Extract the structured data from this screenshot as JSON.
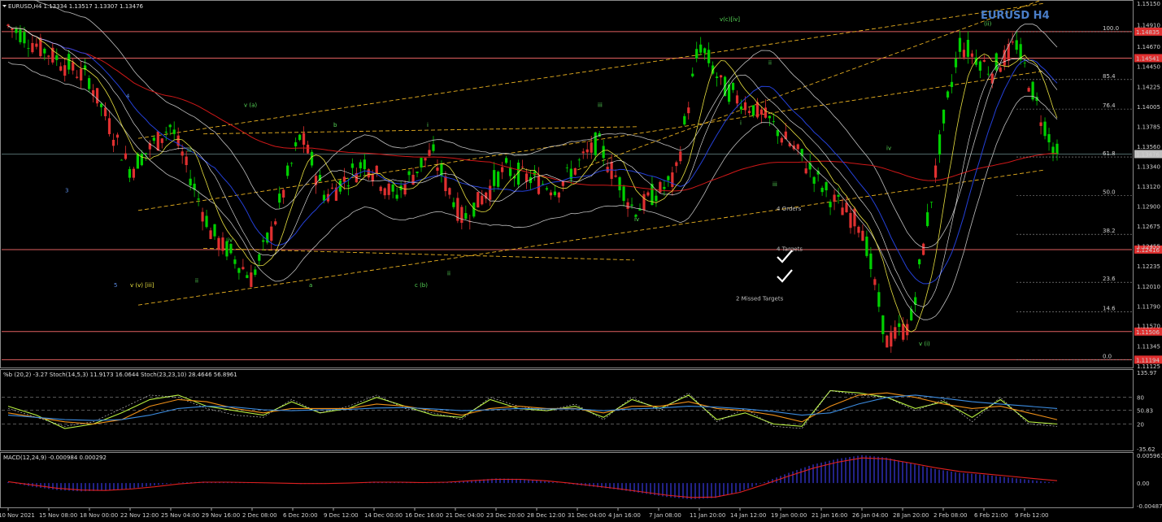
{
  "header": {
    "main": "EURUSD,H4  1.13334 1.13517 1.13307 1.13476",
    "osc": "%b (20,2) -3.27  Stoch(14,5,3) 11.9173 16.0644  Stoch(23,23,10) 28.4646 56.8961",
    "macd": "MACD(12,24,9) -0.000984 0.000292"
  },
  "title": "EURUSD H4",
  "colors": {
    "candle_up": "#00d000",
    "candle_down": "#e03030",
    "ma_red": "#d01818",
    "ma_blue": "#2440d8",
    "ma_yellow": "#e8e040",
    "bollinger": "#bfbfbf",
    "channel": "#e8b020",
    "level_line": "#e06060",
    "wave_green": "#58d858",
    "wave_yellow": "#e8e040",
    "wave_blue": "#5a8ae0",
    "pctb": "#b8f040",
    "stoch_orange": "#f09018",
    "stoch_blue": "#3c8ce0",
    "macd_hist": "#3838e0",
    "macd_signal": "#e02020"
  },
  "chart_data": [
    {
      "type": "candlestick",
      "symbol": "EURUSD",
      "timeframe": "H4",
      "ylim": [
        1.11125,
        1.1515
      ],
      "y_ticks": [
        1.1515,
        1.1491,
        1.1467,
        1.1445,
        1.14225,
        1.14005,
        1.13785,
        1.1356,
        1.1334,
        1.1312,
        1.129,
        1.12675,
        1.12455,
        1.12235,
        1.1201,
        1.1179,
        1.1157,
        1.11345,
        1.11125
      ],
      "current_price": 1.13476,
      "highlighted_levels": [
        1.14835,
        1.14541,
        1.12416,
        1.11506,
        1.11194
      ],
      "x_ticks": [
        "10 Nov 2021",
        "15 Nov 08:00",
        "18 Nov 00:00",
        "22 Nov 12:00",
        "25 Nov 04:00",
        "29 Nov 16:00",
        "2 Dec 08:00",
        "6 Dec 20:00",
        "9 Dec 12:00",
        "14 Dec 00:00",
        "16 Dec 16:00",
        "21 Dec 04:00",
        "23 Dec 20:00",
        "28 Dec 12:00",
        "31 Dec 04:00",
        "4 Jan 16:00",
        "7 Jan 08:00",
        "11 Jan 20:00",
        "14 Jan 12:00",
        "19 Jan 00:00",
        "21 Jan 16:00",
        "26 Jan 04:00",
        "28 Jan 20:00",
        "2 Feb 08:00",
        "6 Feb 21:00",
        "9 Feb 12:00"
      ],
      "fib_levels": [
        "100.0",
        "85.4",
        "76.4",
        "61.8",
        "50.0",
        "38.2",
        "23.6",
        "14.6",
        "0.0"
      ],
      "key_prices": [
        {
          "x": 0,
          "p": 1.149
        },
        {
          "x": 2,
          "p": 1.143
        },
        {
          "x": 3,
          "p": 1.133
        },
        {
          "x": 4,
          "p": 1.138
        },
        {
          "x": 5,
          "p": 1.126
        },
        {
          "x": 6,
          "p": 1.121
        },
        {
          "x": 6.5,
          "p": 1.1265
        },
        {
          "x": 7.2,
          "p": 1.137
        },
        {
          "x": 7.8,
          "p": 1.13
        },
        {
          "x": 8.8,
          "p": 1.134
        },
        {
          "x": 9.5,
          "p": 1.13
        },
        {
          "x": 10.4,
          "p": 1.135
        },
        {
          "x": 11.2,
          "p": 1.1275
        },
        {
          "x": 12.2,
          "p": 1.133
        },
        {
          "x": 13.5,
          "p": 1.131
        },
        {
          "x": 14.5,
          "p": 1.136
        },
        {
          "x": 15.4,
          "p": 1.1285
        },
        {
          "x": 16.4,
          "p": 1.132
        },
        {
          "x": 17.0,
          "p": 1.147
        },
        {
          "x": 17.6,
          "p": 1.142
        },
        {
          "x": 18.6,
          "p": 1.139
        },
        {
          "x": 19.5,
          "p": 1.1345
        },
        {
          "x": 20.2,
          "p": 1.13
        },
        {
          "x": 21.0,
          "p": 1.127
        },
        {
          "x": 21.6,
          "p": 1.114
        },
        {
          "x": 22.2,
          "p": 1.116
        },
        {
          "x": 23.0,
          "p": 1.138
        },
        {
          "x": 23.4,
          "p": 1.147
        },
        {
          "x": 24.2,
          "p": 1.144
        },
        {
          "x": 24.8,
          "p": 1.147
        },
        {
          "x": 25.4,
          "p": 1.139
        },
        {
          "x": 25.8,
          "p": 1.1345
        }
      ],
      "wave_labels": [
        {
          "text": "v (a)",
          "x": 5.8,
          "p": 1.14,
          "c": "green"
        },
        {
          "text": "iii",
          "x": 4.4,
          "p": 1.135,
          "c": "green"
        },
        {
          "text": "iv",
          "x": 5.4,
          "p": 1.125,
          "c": "green"
        },
        {
          "text": "ii",
          "x": 4.6,
          "p": 1.1205,
          "c": "green"
        },
        {
          "text": "b",
          "x": 8.0,
          "p": 1.1378,
          "c": "green"
        },
        {
          "text": "a",
          "x": 7.4,
          "p": 1.12,
          "c": "green"
        },
        {
          "text": "i",
          "x": 10.3,
          "p": 1.1378,
          "c": "green"
        },
        {
          "text": "c (b)",
          "x": 10.0,
          "p": 1.12,
          "c": "green"
        },
        {
          "text": "ii",
          "x": 10.8,
          "p": 1.1213,
          "c": "green"
        },
        {
          "text": "iii",
          "x": 14.5,
          "p": 1.14,
          "c": "green"
        },
        {
          "text": "iv",
          "x": 15.4,
          "p": 1.1273,
          "c": "green"
        },
        {
          "text": "v(c)[iv]",
          "x": 17.5,
          "p": 1.1495,
          "c": "green"
        },
        {
          "text": "i",
          "x": 18.0,
          "p": 1.138,
          "c": "green"
        },
        {
          "text": "ii",
          "x": 18.7,
          "p": 1.1447,
          "c": "green"
        },
        {
          "text": "iii",
          "x": 18.8,
          "p": 1.1312,
          "c": "green"
        },
        {
          "text": "iv",
          "x": 21.6,
          "p": 1.1352,
          "c": "green"
        },
        {
          "text": "v (i)",
          "x": 22.4,
          "p": 1.1135,
          "c": "green"
        },
        {
          "text": "(ii)",
          "x": 24.0,
          "p": 1.149,
          "c": "green"
        },
        {
          "text": "3",
          "x": 1.4,
          "p": 1.1305,
          "c": "blue"
        },
        {
          "text": "4",
          "x": 2.9,
          "p": 1.141,
          "c": "blue"
        },
        {
          "text": "5",
          "x": 2.6,
          "p": 1.12,
          "c": "blue"
        },
        {
          "text": "v (v) [iii]",
          "x": 3.0,
          "p": 1.12,
          "c": "yellow"
        }
      ],
      "annotations": [
        {
          "text": "4 Orders",
          "x": 18.9,
          "p": 1.1285
        },
        {
          "text": "4 Targets",
          "x": 18.9,
          "p": 1.124
        },
        {
          "text": "2 Missed Targets",
          "x": 17.9,
          "p": 1.1185
        }
      ]
    },
    {
      "type": "line",
      "name": "oscillator",
      "ylim": [
        -35.62,
        135.97
      ],
      "y_ticks": [
        "135.97",
        "80",
        "50.83",
        "20",
        "-35.62"
      ],
      "series": [
        {
          "key": "pctb",
          "values": [
            60,
            40,
            10,
            20,
            45,
            75,
            85,
            60,
            50,
            40,
            70,
            45,
            55,
            80,
            60,
            40,
            35,
            75,
            55,
            50,
            60,
            35,
            75,
            55,
            85,
            30,
            45,
            20,
            15,
            95,
            90,
            80,
            55,
            70,
            35,
            75,
            25,
            20
          ]
        },
        {
          "key": "stoch_fast",
          "values": [
            55,
            35,
            15,
            25,
            55,
            85,
            80,
            55,
            40,
            35,
            75,
            45,
            60,
            85,
            55,
            45,
            30,
            80,
            60,
            50,
            65,
            30,
            80,
            50,
            90,
            25,
            55,
            15,
            10,
            95,
            85,
            80,
            50,
            75,
            25,
            80,
            20,
            15
          ]
        },
        {
          "key": "stoch_slow",
          "values": [
            45,
            35,
            25,
            20,
            30,
            60,
            75,
            70,
            55,
            45,
            55,
            55,
            55,
            65,
            60,
            50,
            40,
            55,
            60,
            55,
            55,
            45,
            60,
            60,
            70,
            55,
            50,
            40,
            25,
            60,
            85,
            90,
            80,
            65,
            55,
            60,
            45,
            30
          ]
        },
        {
          "key": "stoch_long",
          "values": [
            40,
            35,
            30,
            28,
            30,
            40,
            55,
            60,
            58,
            52,
            50,
            52,
            53,
            56,
            57,
            54,
            50,
            52,
            55,
            54,
            54,
            50,
            54,
            56,
            60,
            58,
            54,
            48,
            40,
            45,
            65,
            80,
            85,
            78,
            70,
            65,
            60,
            55
          ]
        }
      ]
    },
    {
      "type": "bar",
      "name": "MACD",
      "ylim": [
        -0.004878,
        0.005961
      ],
      "y_ticks": [
        "0.005961",
        "0.00",
        "-0.004878"
      ],
      "hist": [
        0.0002,
        -0.0008,
        -0.0015,
        -0.0018,
        -0.0016,
        -0.0012,
        -0.0005,
        0.0001,
        0.0003,
        0.0002,
        0.0001,
        0.0,
        -0.0002,
        -0.0001,
        0.0,
        0.0003,
        0.0002,
        0.0001,
        0.0002,
        0.0006,
        0.001,
        0.0009,
        0.0004,
        -0.0002,
        -0.0008,
        -0.0014,
        -0.0022,
        -0.003,
        -0.0035,
        -0.0032,
        -0.0018,
        0.0002,
        0.0022,
        0.004,
        0.0052,
        0.006,
        0.0055,
        0.0042,
        0.003,
        0.0022,
        0.0018,
        0.0012,
        0.0006,
        0.0
      ],
      "signal": [
        0.0003,
        -0.0004,
        -0.0011,
        -0.0015,
        -0.0016,
        -0.0013,
        -0.0008,
        -0.0002,
        0.0002,
        0.0002,
        0.0001,
        0.0,
        -0.0001,
        -0.0001,
        0.0,
        0.0002,
        0.0002,
        0.0001,
        0.0002,
        0.0005,
        0.0008,
        0.0008,
        0.0005,
        0.0,
        -0.0006,
        -0.0012,
        -0.0019,
        -0.0026,
        -0.0031,
        -0.003,
        -0.002,
        -0.0003,
        0.0015,
        0.0032,
        0.0045,
        0.0054,
        0.0052,
        0.0043,
        0.0033,
        0.0025,
        0.002,
        0.0015,
        0.001,
        0.0005
      ]
    }
  ]
}
